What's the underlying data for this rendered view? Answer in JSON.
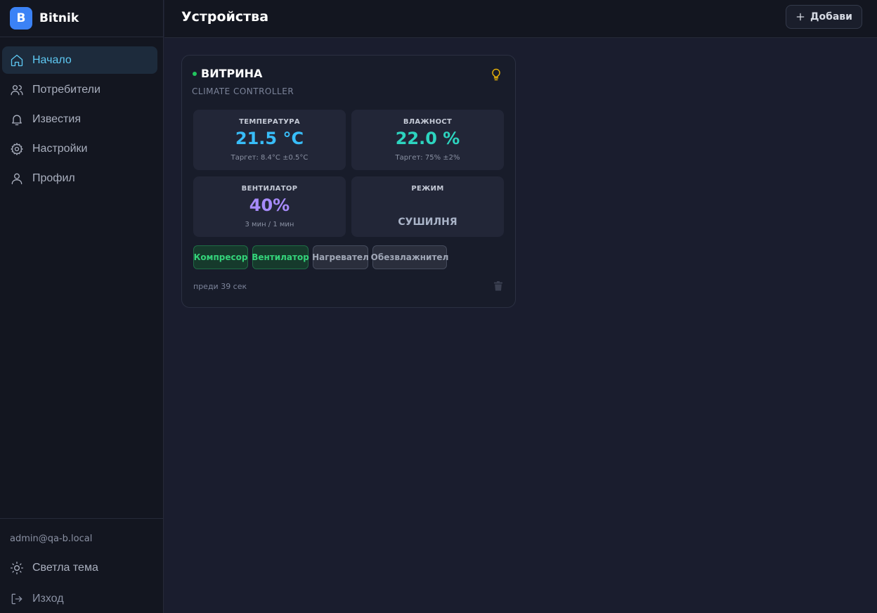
{
  "app": {
    "logo_letter": "B",
    "name": "Bitnik"
  },
  "sidebar": {
    "items": [
      {
        "label": "Начало",
        "icon": "home-icon",
        "active": true
      },
      {
        "label": "Потребители",
        "icon": "users-icon",
        "active": false
      },
      {
        "label": "Известия",
        "icon": "bell-icon",
        "active": false
      },
      {
        "label": "Настройки",
        "icon": "gear-icon",
        "active": false
      },
      {
        "label": "Профил",
        "icon": "user-icon",
        "active": false
      }
    ],
    "user_email": "admin@qa-b.local",
    "theme_label": "Светла тема",
    "logout_label": "Изход"
  },
  "header": {
    "title": "Устройства",
    "add_label": "Добави"
  },
  "device": {
    "name": "ВИТРИНА",
    "type": "CLIMATE CONTROLLER",
    "status": "online",
    "metrics": {
      "temperature": {
        "label": "ТЕМПЕРАТУРА",
        "value": "21.5 °C",
        "sub": "Таргет: 8.4°C ±0.5°C"
      },
      "humidity": {
        "label": "ВЛАЖНОСТ",
        "value": "22.0 %",
        "sub": "Таргет: 75% ±2%"
      },
      "fan": {
        "label": "ВЕНТИЛАТОР",
        "value": "40%",
        "sub": "3 мин / 1 мин"
      },
      "mode": {
        "label": "РЕЖИМ",
        "value": "СУШИЛНЯ"
      }
    },
    "relays": [
      {
        "label": "Компресор",
        "on": true
      },
      {
        "label": "Вентилатор",
        "on": true
      },
      {
        "label": "Нагревател",
        "on": false
      },
      {
        "label": "Обезвлажнител",
        "on": false
      }
    ],
    "updated": "преди 39 сек"
  },
  "colors": {
    "accent": "#3b82f6",
    "active_nav": "#5ec8f2",
    "temperature": "#38bdf8",
    "humidity": "#2dd4bf",
    "fan": "#a78bfa",
    "relay_on": "#34d37a",
    "status_online": "#22c55e",
    "bulb": "#eab308"
  }
}
